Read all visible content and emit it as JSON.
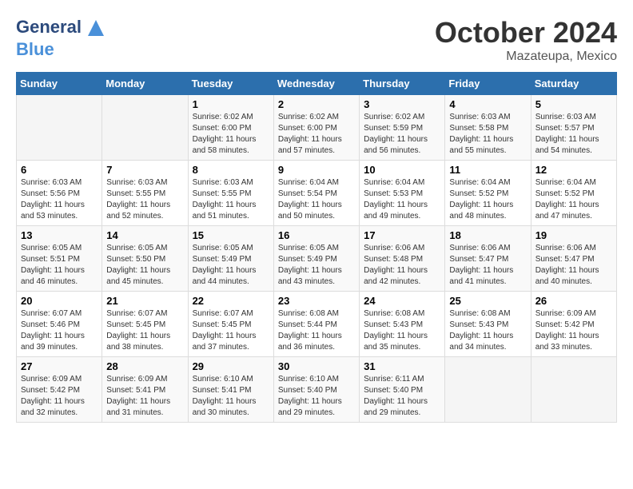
{
  "header": {
    "logo_line1": "General",
    "logo_line2": "Blue",
    "month": "October 2024",
    "location": "Mazateupa, Mexico"
  },
  "weekdays": [
    "Sunday",
    "Monday",
    "Tuesday",
    "Wednesday",
    "Thursday",
    "Friday",
    "Saturday"
  ],
  "weeks": [
    [
      {
        "day": "",
        "sunrise": "",
        "sunset": "",
        "daylight": ""
      },
      {
        "day": "",
        "sunrise": "",
        "sunset": "",
        "daylight": ""
      },
      {
        "day": "1",
        "sunrise": "Sunrise: 6:02 AM",
        "sunset": "Sunset: 6:00 PM",
        "daylight": "Daylight: 11 hours and 58 minutes."
      },
      {
        "day": "2",
        "sunrise": "Sunrise: 6:02 AM",
        "sunset": "Sunset: 6:00 PM",
        "daylight": "Daylight: 11 hours and 57 minutes."
      },
      {
        "day": "3",
        "sunrise": "Sunrise: 6:02 AM",
        "sunset": "Sunset: 5:59 PM",
        "daylight": "Daylight: 11 hours and 56 minutes."
      },
      {
        "day": "4",
        "sunrise": "Sunrise: 6:03 AM",
        "sunset": "Sunset: 5:58 PM",
        "daylight": "Daylight: 11 hours and 55 minutes."
      },
      {
        "day": "5",
        "sunrise": "Sunrise: 6:03 AM",
        "sunset": "Sunset: 5:57 PM",
        "daylight": "Daylight: 11 hours and 54 minutes."
      }
    ],
    [
      {
        "day": "6",
        "sunrise": "Sunrise: 6:03 AM",
        "sunset": "Sunset: 5:56 PM",
        "daylight": "Daylight: 11 hours and 53 minutes."
      },
      {
        "day": "7",
        "sunrise": "Sunrise: 6:03 AM",
        "sunset": "Sunset: 5:55 PM",
        "daylight": "Daylight: 11 hours and 52 minutes."
      },
      {
        "day": "8",
        "sunrise": "Sunrise: 6:03 AM",
        "sunset": "Sunset: 5:55 PM",
        "daylight": "Daylight: 11 hours and 51 minutes."
      },
      {
        "day": "9",
        "sunrise": "Sunrise: 6:04 AM",
        "sunset": "Sunset: 5:54 PM",
        "daylight": "Daylight: 11 hours and 50 minutes."
      },
      {
        "day": "10",
        "sunrise": "Sunrise: 6:04 AM",
        "sunset": "Sunset: 5:53 PM",
        "daylight": "Daylight: 11 hours and 49 minutes."
      },
      {
        "day": "11",
        "sunrise": "Sunrise: 6:04 AM",
        "sunset": "Sunset: 5:52 PM",
        "daylight": "Daylight: 11 hours and 48 minutes."
      },
      {
        "day": "12",
        "sunrise": "Sunrise: 6:04 AM",
        "sunset": "Sunset: 5:52 PM",
        "daylight": "Daylight: 11 hours and 47 minutes."
      }
    ],
    [
      {
        "day": "13",
        "sunrise": "Sunrise: 6:05 AM",
        "sunset": "Sunset: 5:51 PM",
        "daylight": "Daylight: 11 hours and 46 minutes."
      },
      {
        "day": "14",
        "sunrise": "Sunrise: 6:05 AM",
        "sunset": "Sunset: 5:50 PM",
        "daylight": "Daylight: 11 hours and 45 minutes."
      },
      {
        "day": "15",
        "sunrise": "Sunrise: 6:05 AM",
        "sunset": "Sunset: 5:49 PM",
        "daylight": "Daylight: 11 hours and 44 minutes."
      },
      {
        "day": "16",
        "sunrise": "Sunrise: 6:05 AM",
        "sunset": "Sunset: 5:49 PM",
        "daylight": "Daylight: 11 hours and 43 minutes."
      },
      {
        "day": "17",
        "sunrise": "Sunrise: 6:06 AM",
        "sunset": "Sunset: 5:48 PM",
        "daylight": "Daylight: 11 hours and 42 minutes."
      },
      {
        "day": "18",
        "sunrise": "Sunrise: 6:06 AM",
        "sunset": "Sunset: 5:47 PM",
        "daylight": "Daylight: 11 hours and 41 minutes."
      },
      {
        "day": "19",
        "sunrise": "Sunrise: 6:06 AM",
        "sunset": "Sunset: 5:47 PM",
        "daylight": "Daylight: 11 hours and 40 minutes."
      }
    ],
    [
      {
        "day": "20",
        "sunrise": "Sunrise: 6:07 AM",
        "sunset": "Sunset: 5:46 PM",
        "daylight": "Daylight: 11 hours and 39 minutes."
      },
      {
        "day": "21",
        "sunrise": "Sunrise: 6:07 AM",
        "sunset": "Sunset: 5:45 PM",
        "daylight": "Daylight: 11 hours and 38 minutes."
      },
      {
        "day": "22",
        "sunrise": "Sunrise: 6:07 AM",
        "sunset": "Sunset: 5:45 PM",
        "daylight": "Daylight: 11 hours and 37 minutes."
      },
      {
        "day": "23",
        "sunrise": "Sunrise: 6:08 AM",
        "sunset": "Sunset: 5:44 PM",
        "daylight": "Daylight: 11 hours and 36 minutes."
      },
      {
        "day": "24",
        "sunrise": "Sunrise: 6:08 AM",
        "sunset": "Sunset: 5:43 PM",
        "daylight": "Daylight: 11 hours and 35 minutes."
      },
      {
        "day": "25",
        "sunrise": "Sunrise: 6:08 AM",
        "sunset": "Sunset: 5:43 PM",
        "daylight": "Daylight: 11 hours and 34 minutes."
      },
      {
        "day": "26",
        "sunrise": "Sunrise: 6:09 AM",
        "sunset": "Sunset: 5:42 PM",
        "daylight": "Daylight: 11 hours and 33 minutes."
      }
    ],
    [
      {
        "day": "27",
        "sunrise": "Sunrise: 6:09 AM",
        "sunset": "Sunset: 5:42 PM",
        "daylight": "Daylight: 11 hours and 32 minutes."
      },
      {
        "day": "28",
        "sunrise": "Sunrise: 6:09 AM",
        "sunset": "Sunset: 5:41 PM",
        "daylight": "Daylight: 11 hours and 31 minutes."
      },
      {
        "day": "29",
        "sunrise": "Sunrise: 6:10 AM",
        "sunset": "Sunset: 5:41 PM",
        "daylight": "Daylight: 11 hours and 30 minutes."
      },
      {
        "day": "30",
        "sunrise": "Sunrise: 6:10 AM",
        "sunset": "Sunset: 5:40 PM",
        "daylight": "Daylight: 11 hours and 29 minutes."
      },
      {
        "day": "31",
        "sunrise": "Sunrise: 6:11 AM",
        "sunset": "Sunset: 5:40 PM",
        "daylight": "Daylight: 11 hours and 29 minutes."
      },
      {
        "day": "",
        "sunrise": "",
        "sunset": "",
        "daylight": ""
      },
      {
        "day": "",
        "sunrise": "",
        "sunset": "",
        "daylight": ""
      }
    ]
  ]
}
